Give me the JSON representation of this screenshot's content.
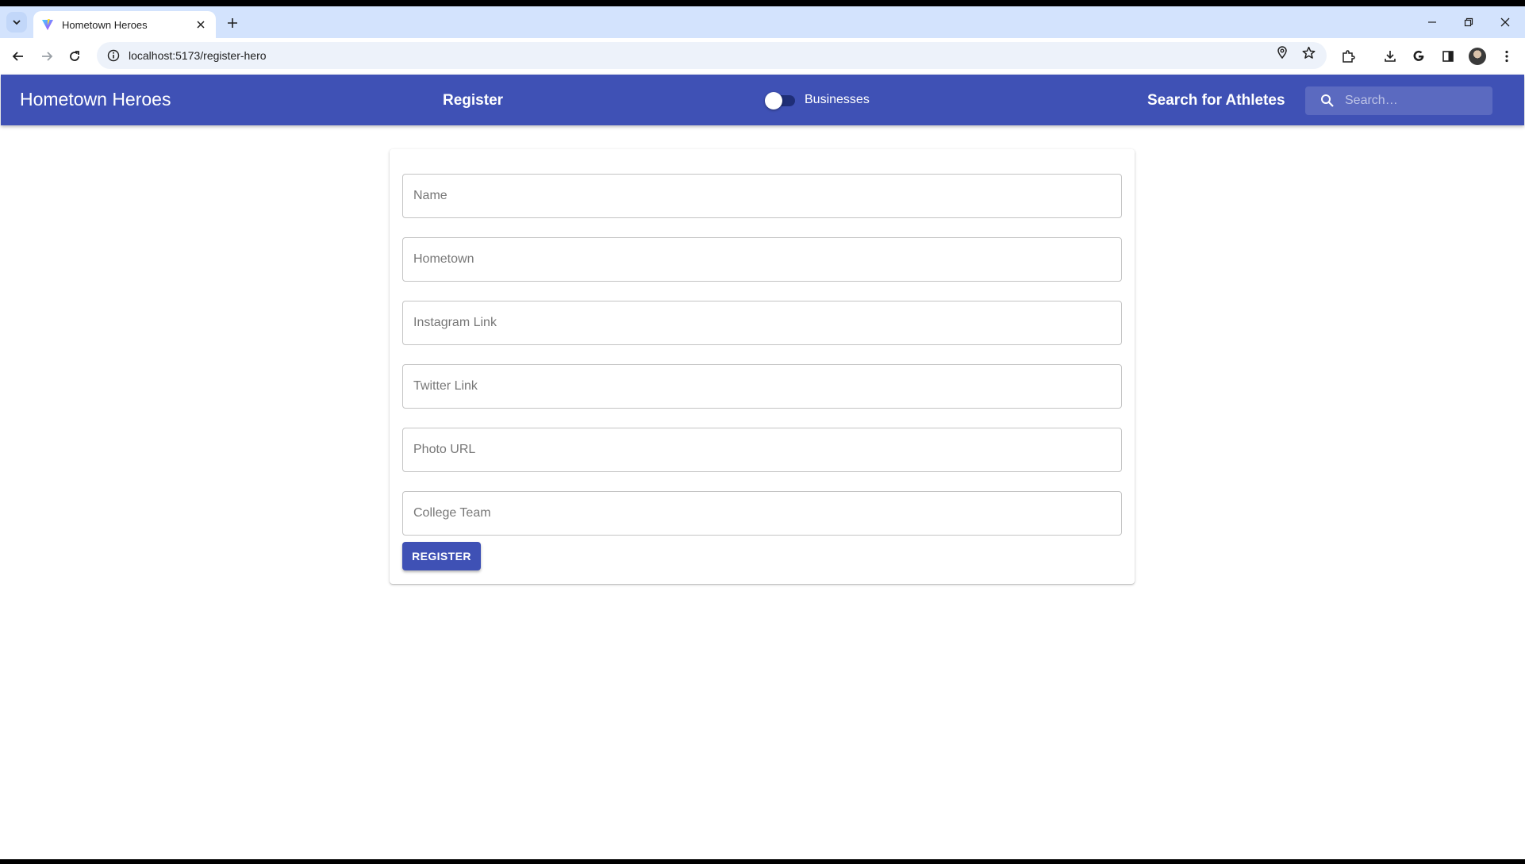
{
  "browser": {
    "tab_title": "Hometown Heroes",
    "url": "localhost:5173/register-hero"
  },
  "appbar": {
    "title": "Hometown Heroes",
    "register_label": "Register",
    "switch_label": "Businesses",
    "switch_on": false,
    "search_title": "Search for Athletes",
    "search_placeholder": "Search…"
  },
  "form": {
    "fields": [
      {
        "placeholder": "Name",
        "value": ""
      },
      {
        "placeholder": "Hometown",
        "value": ""
      },
      {
        "placeholder": "Instagram Link",
        "value": ""
      },
      {
        "placeholder": "Twitter Link",
        "value": ""
      },
      {
        "placeholder": "Photo URL",
        "value": ""
      },
      {
        "placeholder": "College Team",
        "value": ""
      }
    ],
    "submit_label": "REGISTER"
  },
  "colors": {
    "primary": "#3f51b5",
    "tabstrip": "#d3e3fd",
    "omnibox": "#edf2fa"
  }
}
